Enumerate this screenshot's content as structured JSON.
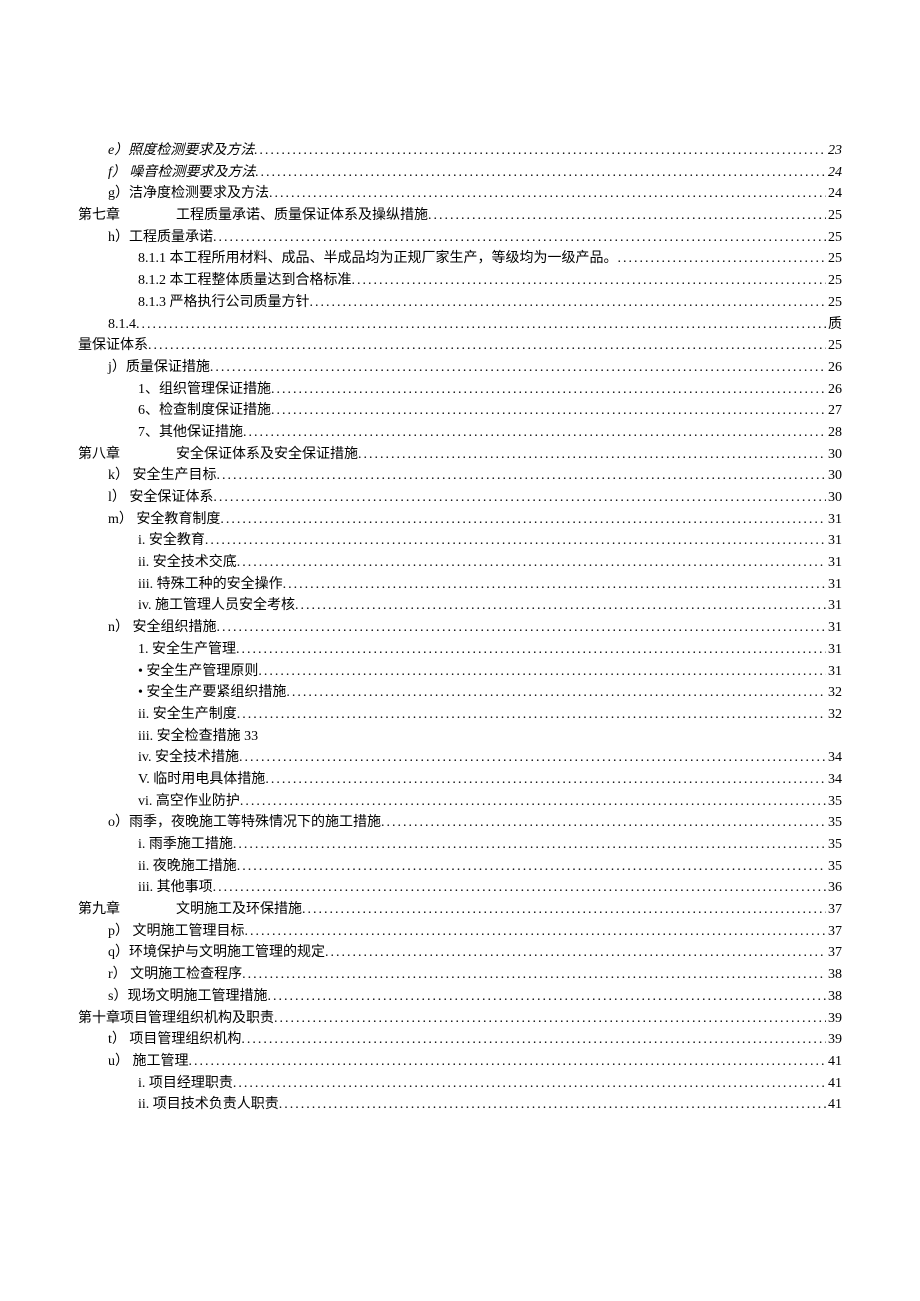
{
  "toc": [
    {
      "indent": 1,
      "label": "e）照度检测要求及方法",
      "page": "23",
      "italic": true
    },
    {
      "indent": 1,
      "label": "f） 噪音检测要求及方法",
      "page": "24",
      "italic": true
    },
    {
      "indent": 1,
      "label": "g）洁净度检测要求及方法",
      "page": "24"
    },
    {
      "indent": 0,
      "chapter": true,
      "prefix": "第七章",
      "title": "工程质量承诺、质量保证体系及操纵措施",
      "page": "25"
    },
    {
      "indent": 1,
      "label": "h）工程质量承诺",
      "page": "25"
    },
    {
      "indent": 2,
      "label": "8.1.1 本工程所用材料、成品、半成品均为正规厂家生产，等级均为一级产品。",
      "page": "25"
    },
    {
      "indent": 2,
      "label": "8.1.2 本工程整体质量达到合格标准",
      "page": "25"
    },
    {
      "indent": 2,
      "label": "8.1.3 严格执行公司质量方针",
      "page": "25"
    },
    {
      "wrap": true,
      "line1": "8.1.4",
      "suffix": "质",
      "line2": "量保证体系",
      "page": "25"
    },
    {
      "indent": 1,
      "label": "j）质量保证措施",
      "page": "26"
    },
    {
      "indent": 2,
      "label": "1、组织管理保证措施",
      "page": "26"
    },
    {
      "indent": 2,
      "label": "6、检查制度保证措施",
      "page": "27"
    },
    {
      "indent": 2,
      "label": "7、其他保证措施",
      "page": "28"
    },
    {
      "indent": 0,
      "chapter": true,
      "prefix": "第八章",
      "title": "安全保证体系及安全保证措施",
      "page": "30"
    },
    {
      "indent": 1,
      "label": "k） 安全生产目标",
      "page": "30"
    },
    {
      "indent": 1,
      "label": "l） 安全保证体系",
      "page": "30"
    },
    {
      "indent": 1,
      "label": "m） 安全教育制度",
      "page": "31"
    },
    {
      "indent": 2,
      "label": "i.  安全教育",
      "page": "31"
    },
    {
      "indent": 2,
      "label": "ii. 安全技术交底",
      "page": "31"
    },
    {
      "indent": 2,
      "label": "iii. 特殊工种的安全操作",
      "page": "31"
    },
    {
      "indent": 2,
      "label": "iv. 施工管理人员安全考核",
      "page": "31"
    },
    {
      "indent": 1,
      "label": "n） 安全组织措施",
      "page": "31"
    },
    {
      "indent": 2,
      "label": "1.  安全生产管理",
      "page": "31"
    },
    {
      "indent": 2,
      "label": "•   安全生产管理原则",
      "page": "31"
    },
    {
      "indent": 2,
      "label": "•   安全生产要紧组织措施",
      "page": "32"
    },
    {
      "indent": 2,
      "label": "ii. 安全生产制度",
      "page": "32"
    },
    {
      "plain": true,
      "label": "iii. 安全检查措施   33"
    },
    {
      "indent": 2,
      "label": "iv. 安全技术措施",
      "page": "34"
    },
    {
      "indent": 2,
      "label": "V.   临时用电具体措施",
      "page": "34"
    },
    {
      "indent": 2,
      "label": "vi.    高空作业防护",
      "page": "35"
    },
    {
      "indent": 1,
      "label": "o）雨季，夜晚施工等特殊情况下的施工措施",
      "page": "35"
    },
    {
      "indent": 2,
      "label": "i.  雨季施工措施",
      "page": "35"
    },
    {
      "indent": 2,
      "label": "ii. 夜晚施工措施",
      "page": "35"
    },
    {
      "indent": 2,
      "label": "iii. 其他事项",
      "page": "36"
    },
    {
      "indent": 0,
      "chapter": true,
      "prefix": "第九章",
      "title": "文明施工及环保措施",
      "page": "37"
    },
    {
      "indent": 1,
      "label": "p） 文明施工管理目标",
      "page": "37"
    },
    {
      "indent": 1,
      "label": "q）环境保护与文明施工管理的规定",
      "page": "37"
    },
    {
      "indent": 1,
      "label": "r） 文明施工检查程序",
      "page": "38"
    },
    {
      "indent": 1,
      "label": "s）现场文明施工管理措施",
      "page": "38"
    },
    {
      "indent": 0,
      "label": "第十章项目管理组织机构及职责",
      "page": "39"
    },
    {
      "indent": 1,
      "label": "t） 项目管理组织机构",
      "page": "39"
    },
    {
      "indent": 1,
      "label": "u） 施工管理",
      "page": "41"
    },
    {
      "indent": 2,
      "label": "i.  项目经理职责",
      "page": "41"
    },
    {
      "indent": 2,
      "label": "ii. 项目技术负责人职责",
      "page": "41"
    }
  ]
}
